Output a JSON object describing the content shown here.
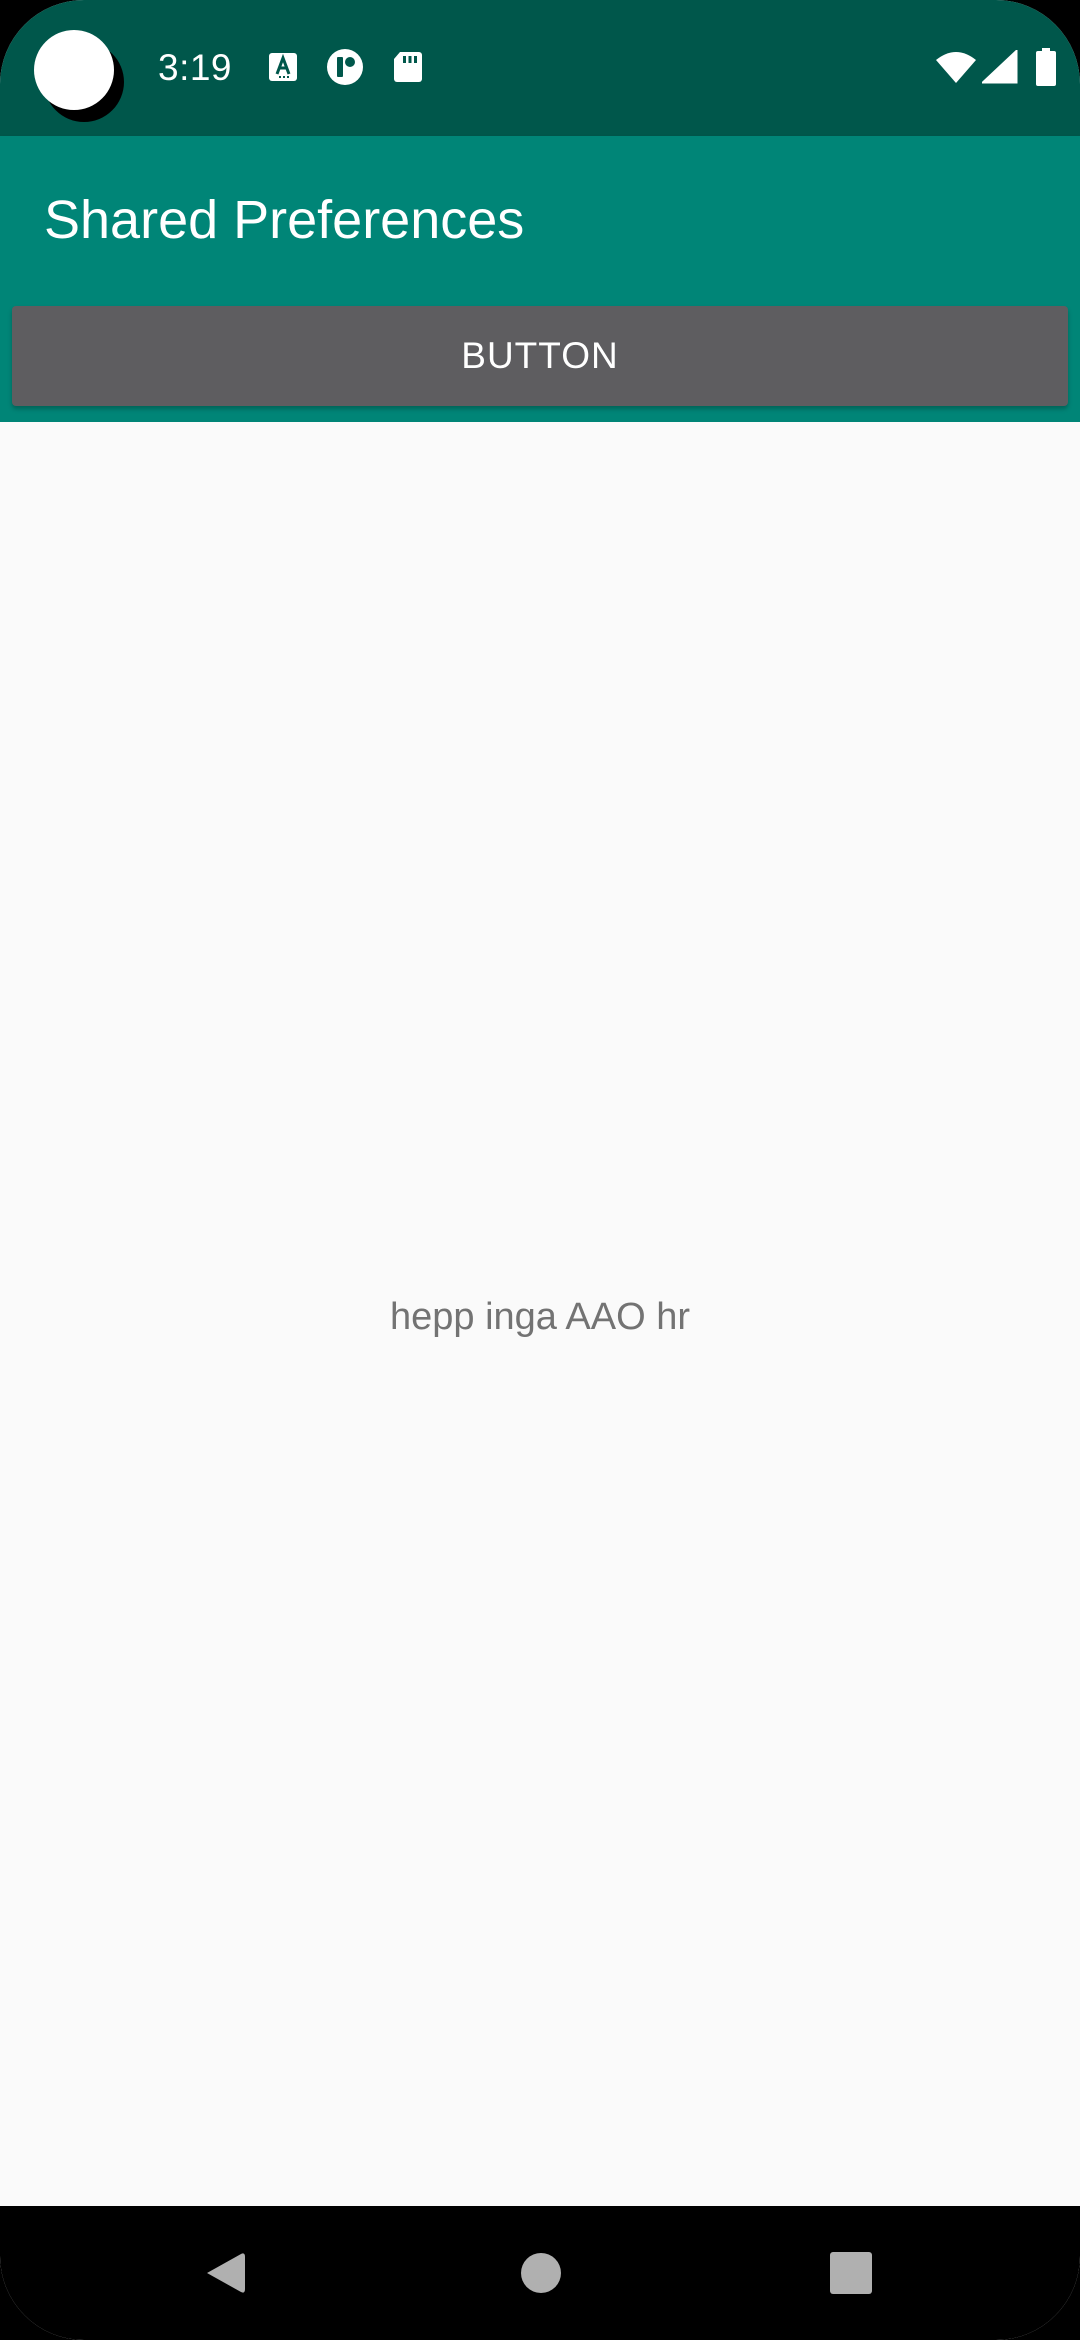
{
  "status_bar": {
    "time": "3:19",
    "icons": [
      "text-a-icon",
      "t-app-icon",
      "sd-card-icon",
      "wifi-icon",
      "signal-icon",
      "battery-icon"
    ]
  },
  "app_bar": {
    "title": "Shared Preferences",
    "button_label": "BUTTON"
  },
  "content": {
    "text": "hepp inga AAO hr"
  },
  "nav_bar": {
    "buttons": [
      "back-icon",
      "home-icon",
      "recents-icon"
    ]
  },
  "colors": {
    "status_bar": "#00574b",
    "app_bar": "#008577",
    "button": "#5e5d60",
    "background": "#fafafa",
    "text_secondary": "#737373"
  }
}
